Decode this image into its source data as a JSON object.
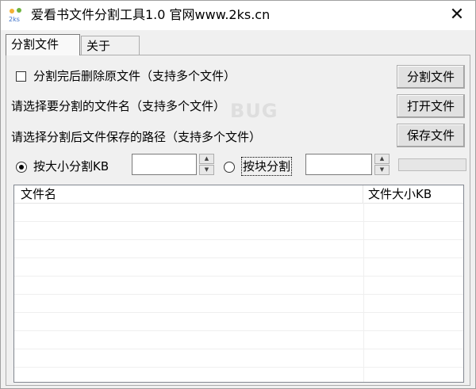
{
  "window": {
    "title": "爱看书文件分割工具1.0  官网www.2ks.cn",
    "close_glyph": "✕",
    "app_icon_text": "2ks"
  },
  "tabs": [
    {
      "label": "分割文件",
      "active": true
    },
    {
      "label": "关于",
      "active": false
    }
  ],
  "options": {
    "delete_after_split_label": "分割完后删除原文件（支持多个文件）",
    "delete_after_split_checked": false,
    "select_file_label": "请选择要分割的文件名（支持多个文件）",
    "select_path_label": "请选择分割后文件保存的路径（支持多个文件）"
  },
  "buttons": {
    "split": "分割文件",
    "open": "打开文件",
    "save": "保存文件"
  },
  "mode": {
    "by_size_label": "按大小分割KB",
    "by_size_selected": true,
    "by_size_value": "",
    "by_block_label": "按块分割",
    "by_block_selected": false,
    "by_block_value": ""
  },
  "progress": {
    "value": 0
  },
  "file_list": {
    "columns": [
      "文件名",
      "文件大小KB"
    ],
    "rows": []
  },
  "watermark": "BUG"
}
